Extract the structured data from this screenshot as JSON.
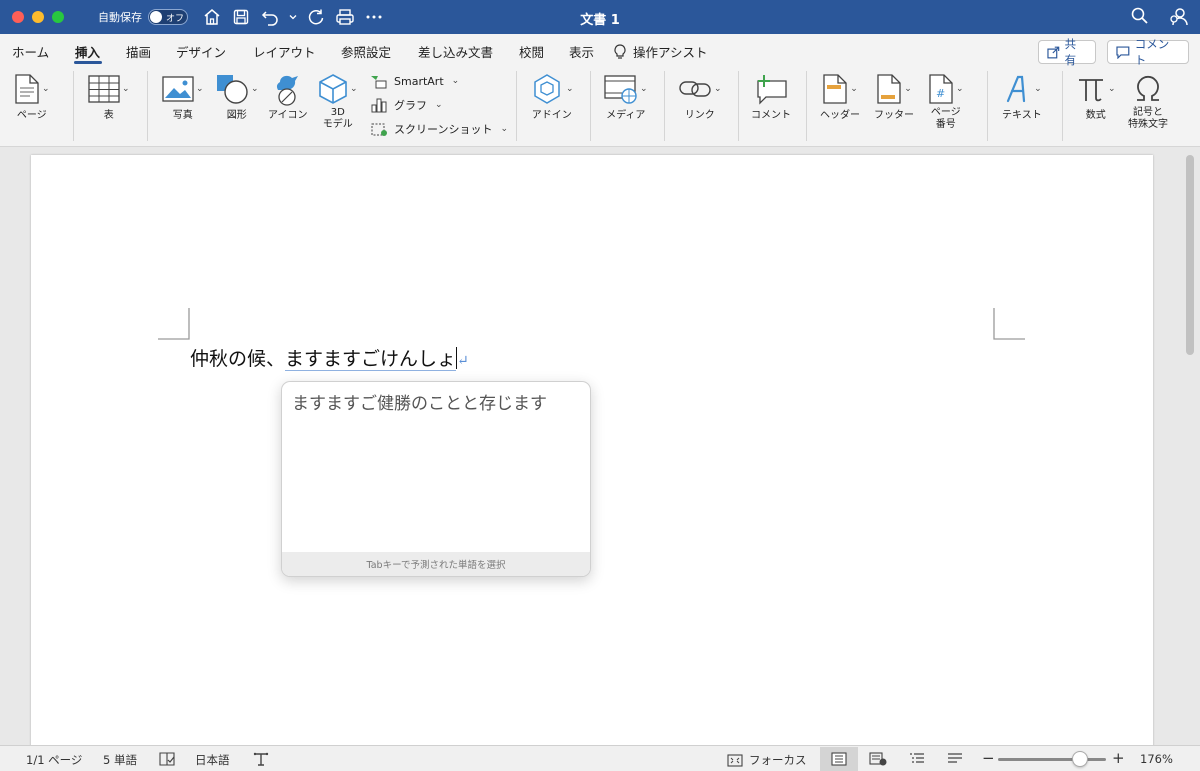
{
  "window": {
    "title": "文書 1",
    "autosave_label": "自動保存",
    "autosave_state": "オフ"
  },
  "tabs": [
    "ホーム",
    "挿入",
    "描画",
    "デザイン",
    "レイアウト",
    "参照設定",
    "差し込み文書",
    "校閲",
    "表示"
  ],
  "active_tab": "挿入",
  "tell_me": "操作アシスト",
  "share_label": "共有",
  "comment_label": "コメント",
  "ribbon": {
    "page": "ページ",
    "table": "表",
    "photo": "写真",
    "shapes": "図形",
    "icons": "アイコン",
    "models_3d_line1": "3D",
    "models_3d_line2": "モデル",
    "smartart": "SmartArt",
    "chart": "グラフ",
    "screenshot": "スクリーンショット",
    "addins": "アドイン",
    "media": "メディア",
    "link": "リンク",
    "comment": "コメント",
    "header": "ヘッダー",
    "footer": "フッター",
    "page_number_line1": "ページ",
    "page_number_line2": "番号",
    "text": "テキスト",
    "equation": "数式",
    "symbols_line1": "記号と",
    "symbols_line2": "特殊文字"
  },
  "document": {
    "typed_text": "仲秋の候、",
    "composing_text": "ますますごけんしょ"
  },
  "prediction": {
    "suggestion": "ますますご健勝のことと存じます",
    "hint": "Tabキーで予測された単語を選択"
  },
  "status": {
    "page": "1/1 ページ",
    "words": "5 単語",
    "language": "日本語",
    "focus": "フォーカス",
    "zoom": "176%",
    "zoom_level": 0.76
  },
  "colors": {
    "brand": "#2b579a",
    "close": "#ff5f57",
    "minimize": "#febc2e",
    "maximize": "#28c840"
  }
}
